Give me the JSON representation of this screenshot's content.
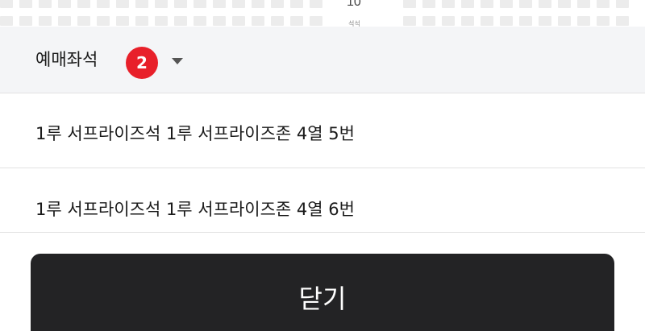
{
  "seat_map": {
    "row_number": "10",
    "row_sub": "석석"
  },
  "header": {
    "title": "예매좌석",
    "count": "2"
  },
  "seats": [
    {
      "label": "1루 서프라이즈석 1루 서프라이즈존 4열 5번"
    },
    {
      "label": "1루 서프라이즈석 1루 서프라이즈존 4열 6번"
    }
  ],
  "close_button": {
    "label": "닫기"
  },
  "colors": {
    "badge": "#e8202a",
    "button_bg": "#232325",
    "header_bg": "#f4f5f7"
  }
}
